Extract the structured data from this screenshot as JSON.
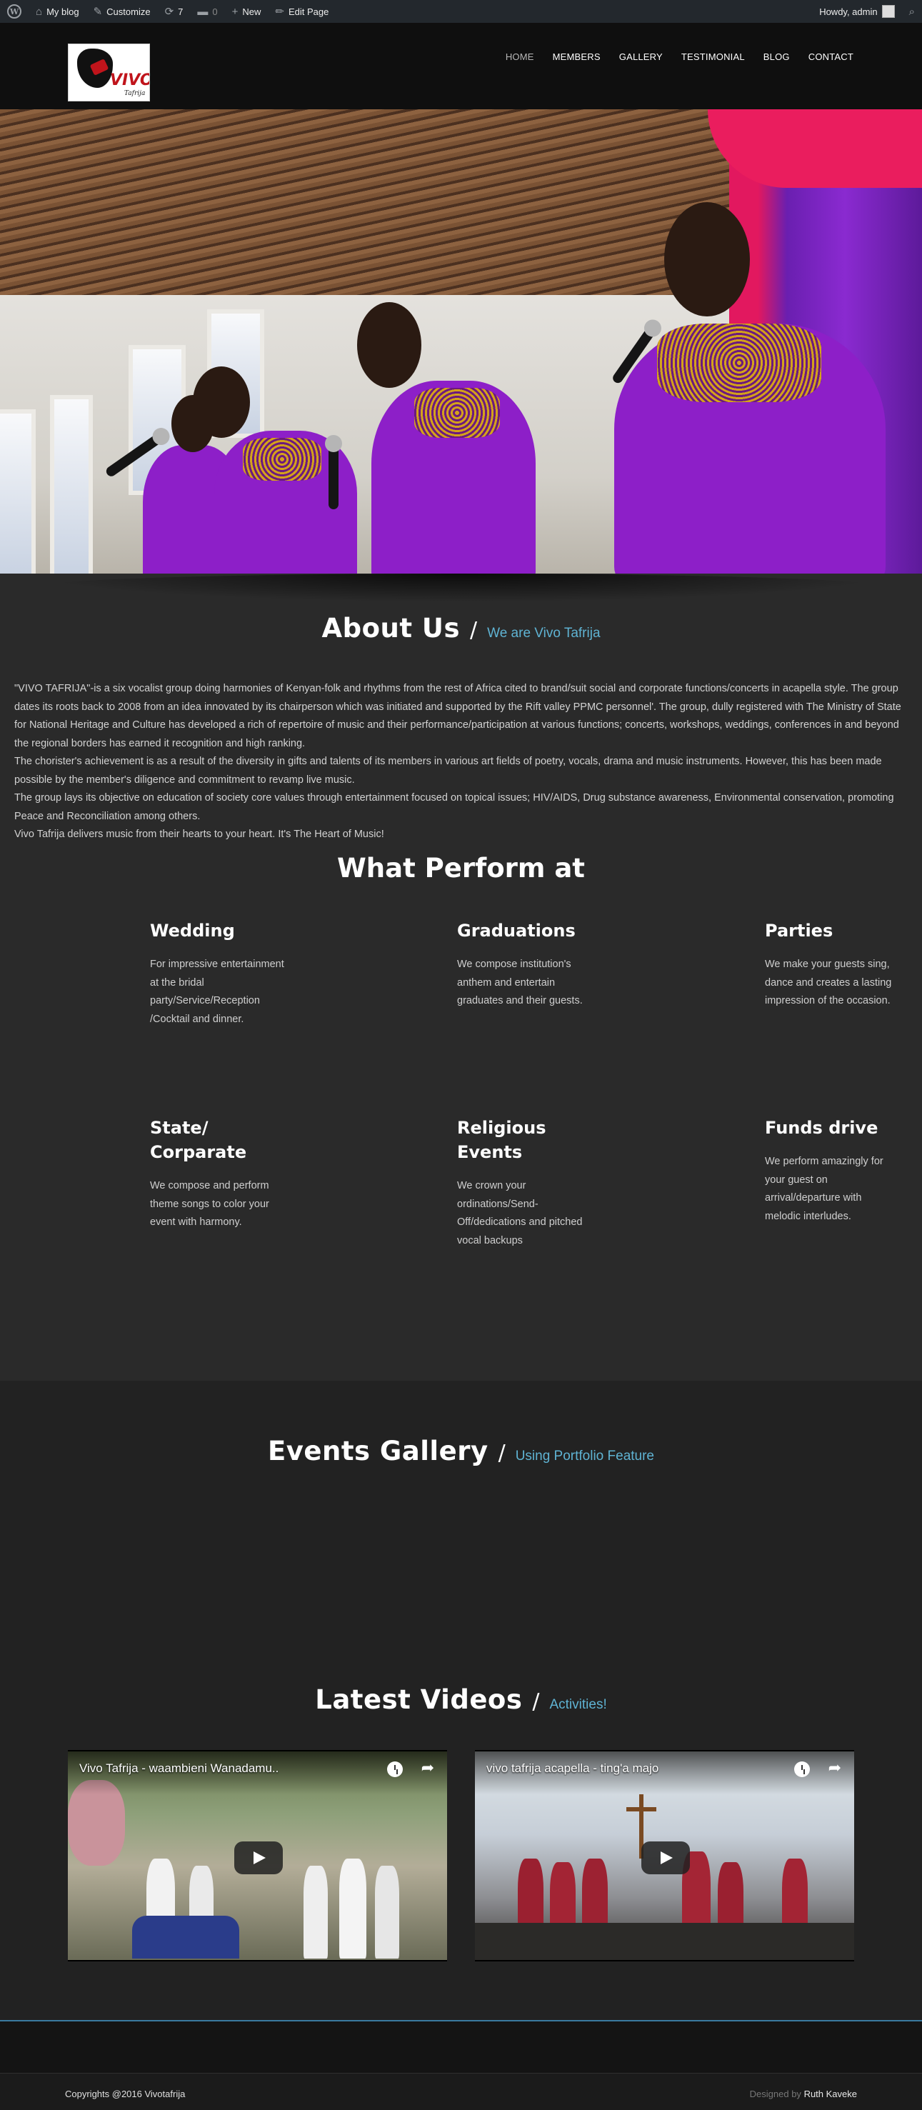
{
  "adminbar": {
    "my_blog": "My blog",
    "customize": "Customize",
    "updates_count": "7",
    "comments_count": "0",
    "new": "New",
    "edit_page": "Edit Page",
    "howdy": "Howdy, admin"
  },
  "header": {
    "logo_text": "VIVO",
    "logo_sub": "Tafrija",
    "nav": [
      "HOME",
      "MEMBERS",
      "GALLERY",
      "TESTIMONIAL",
      "BLOG",
      "CONTACT"
    ],
    "active_nav": "HOME"
  },
  "about": {
    "title": "About Us",
    "slash": "/",
    "subtitle": "We are Vivo Tafrija",
    "paragraphs": [
      "\"VIVO TAFRIJA\"-is a six vocalist group doing harmonies of Kenyan-folk and rhythms from the rest of Africa cited to brand/suit social and corporate functions/concerts in acapella style. The group dates its roots back to 2008 from an idea innovated by its chairperson which was initiated and supported by the Rift valley PPMC personnel'. The group, dully registered with The Ministry of State for National Heritage and Culture has developed a rich of repertoire of music and their performance/participation at various functions; concerts, workshops, weddings, conferences in and beyond the regional borders has earned it recognition and high ranking.",
      "The chorister's achievement is as a result of the diversity in gifts and talents of its members in various art fields of poetry, vocals, drama and music instruments. However, this has been made possible by the member's diligence and commitment to revamp live music.",
      "The group lays its objective on education of society core values through entertainment focused on topical issues; HIV/AIDS, Drug substance awareness, Environmental conservation, promoting Peace and Reconciliation among others.",
      "Vivo Tafrija delivers music from their hearts to your heart. It's The Heart of Music!"
    ]
  },
  "perform": {
    "title": "What Perform at",
    "items": [
      {
        "title": "Wedding",
        "text": "For impressive entertainment at the bridal party/Service/Reception /Cocktail and dinner."
      },
      {
        "title": "Graduations",
        "text": "We compose institution's anthem and entertain graduates and their guests."
      },
      {
        "title": "Parties",
        "text": "We make your guests sing, dance  and creates a lasting impression of the occasion."
      },
      {
        "title": "State/ Corparate",
        "text": "We compose and perform theme songs to color your event with harmony."
      },
      {
        "title": "Religious Events",
        "text": "We crown your ordinations/Send-Off/dedications and pitched vocal backups"
      },
      {
        "title": "Funds drive",
        "text": "We perform amazingly for your guest on arrival/departure with melodic interludes."
      }
    ]
  },
  "gallery": {
    "title": "Events Gallery",
    "slash": "/",
    "subtitle": "Using Portfolio Feature"
  },
  "videos": {
    "title": "Latest Videos",
    "slash": "/",
    "subtitle": "Activities!",
    "items": [
      {
        "title": "Vivo Tafrija - waambieni Wanadamu.."
      },
      {
        "title": "vivo tafrija acapella - ting'a majo"
      }
    ]
  },
  "footer": {
    "copyright": "Copyrights @2016 Vivotafrija",
    "designed_by_label": "Designed by",
    "designer": "Ruth Kaveke"
  },
  "colors": {
    "accent": "#5fb3d3",
    "background": "#2a2a2a",
    "header": "#0f0f0f",
    "adminbar": "#23282d"
  }
}
